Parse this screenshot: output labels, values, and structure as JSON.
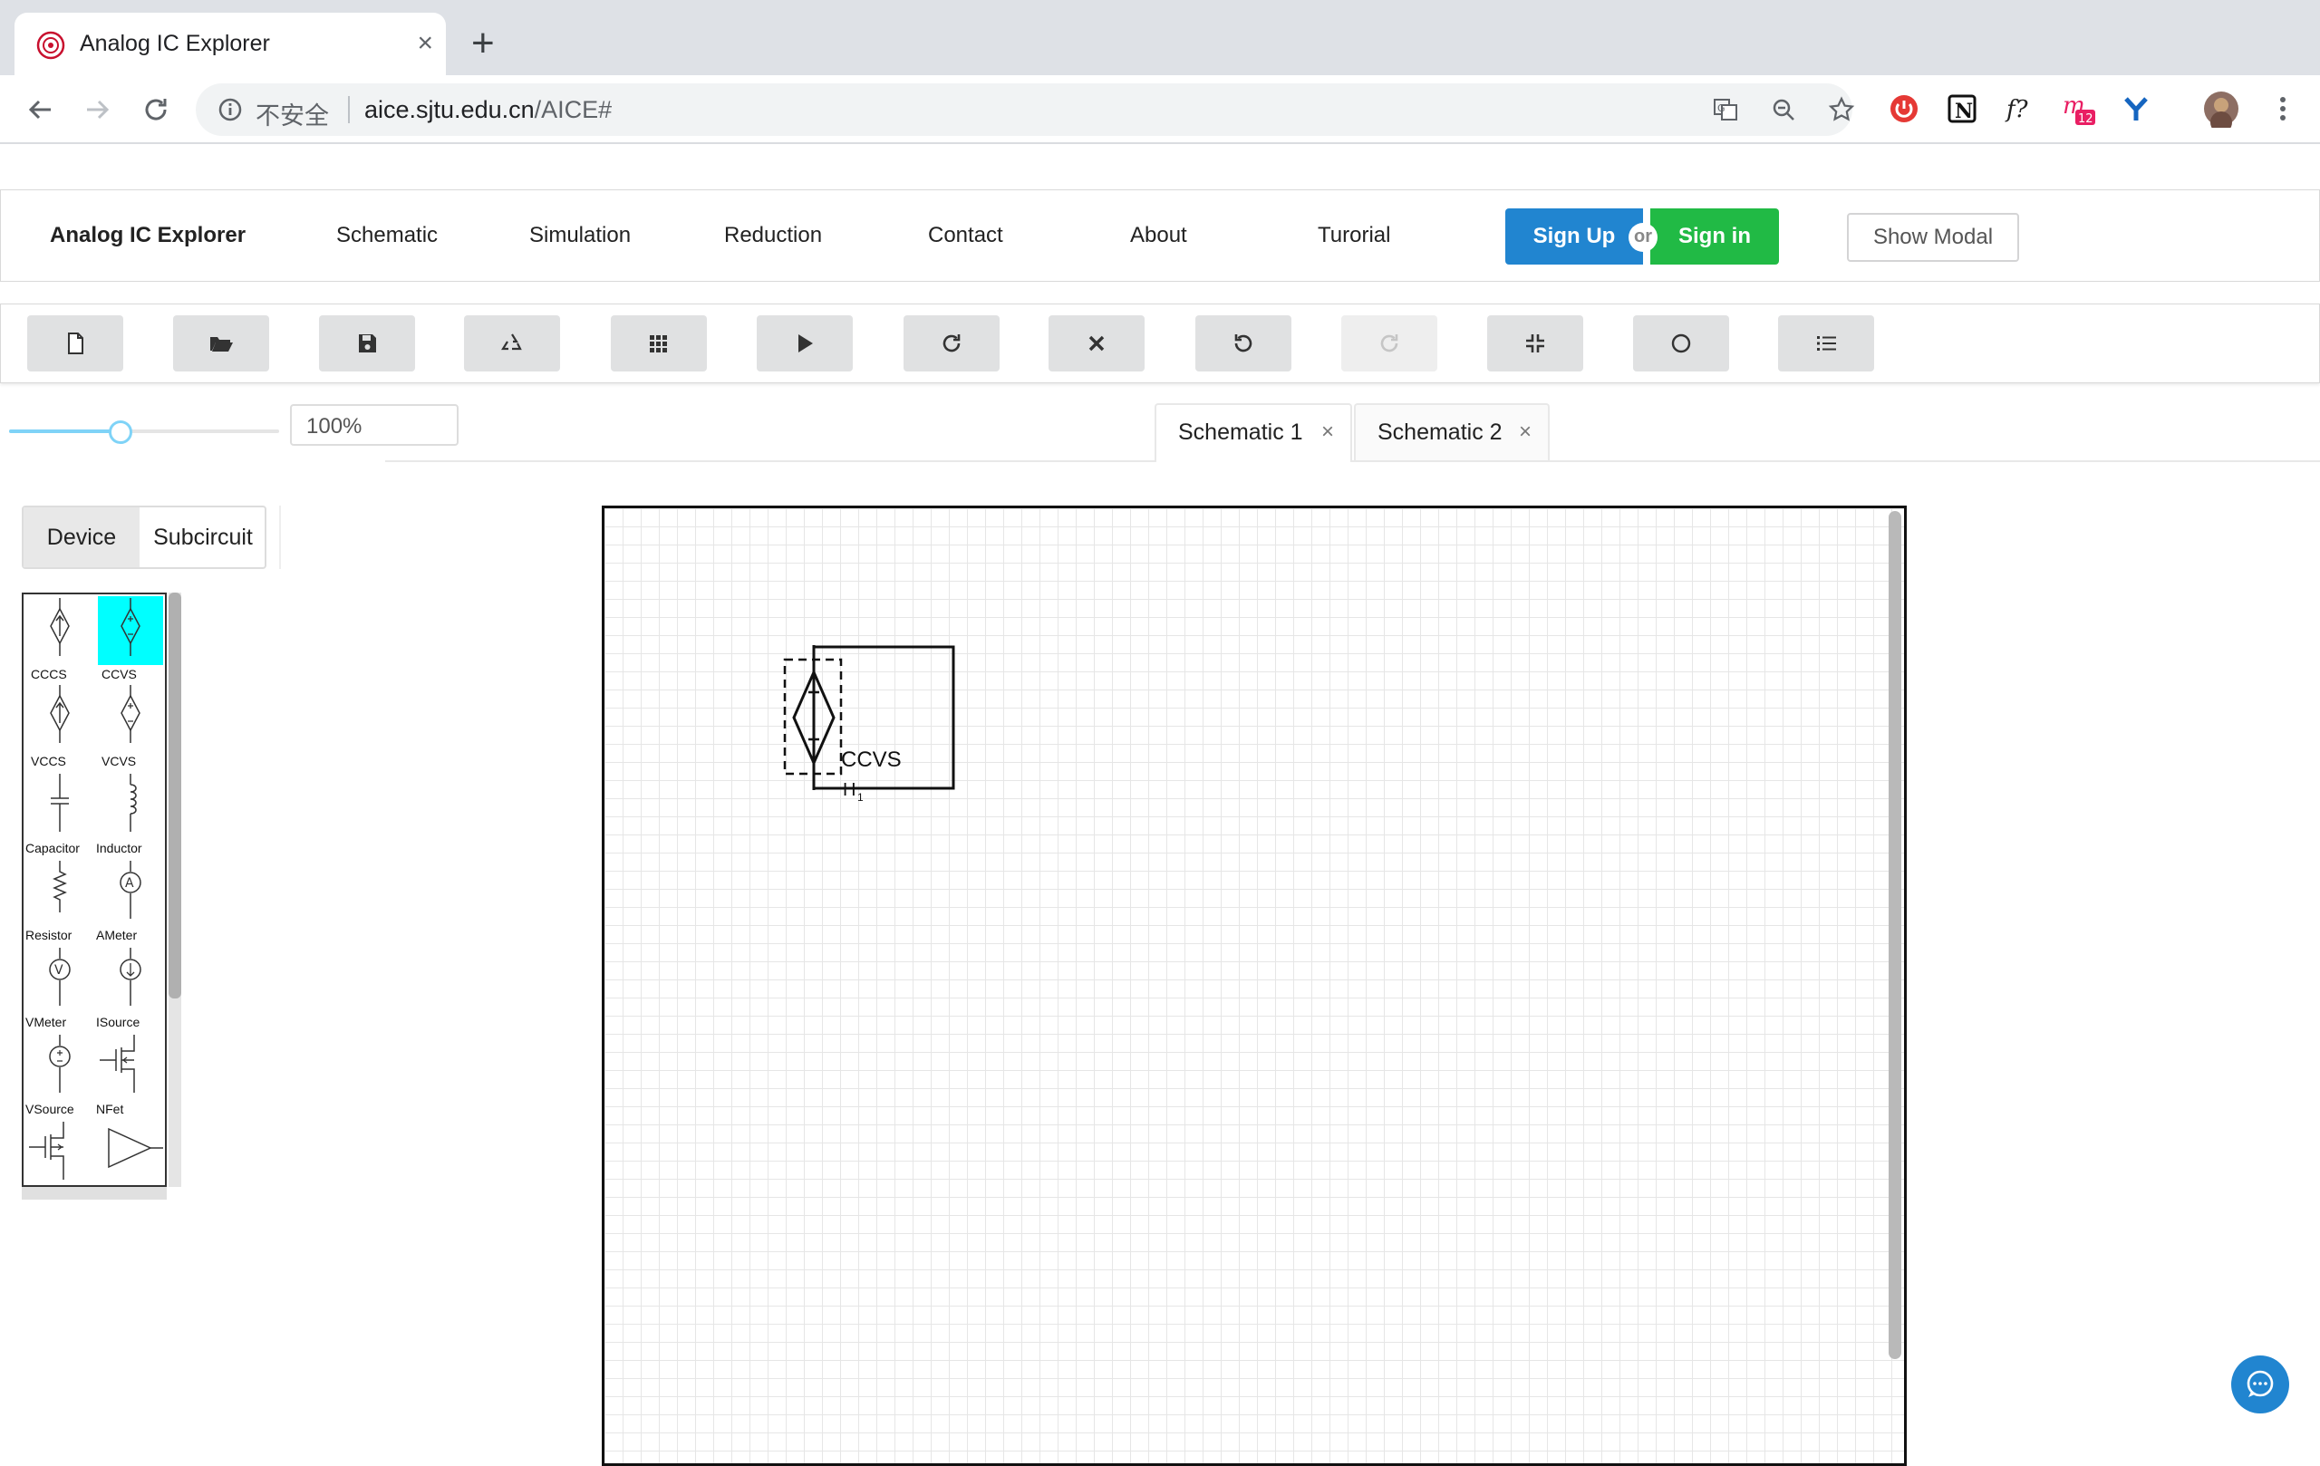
{
  "browser": {
    "tab_title": "Analog IC Explorer",
    "tab_close": "×",
    "new_tab": "+",
    "security_label": "不安全",
    "url_domain": "aice.sjtu.edu.cn",
    "url_path": "/AICE#",
    "extension_badge": "12"
  },
  "navbar": {
    "brand": "Analog IC Explorer",
    "links": [
      "Schematic",
      "Simulation",
      "Reduction",
      "Contact",
      "About",
      "Turorial"
    ],
    "signup": "Sign Up",
    "or": "or",
    "signin": "Sign in",
    "show_modal": "Show Modal"
  },
  "toolbar": {
    "buttons": [
      "new-file",
      "open-folder",
      "save",
      "recycle",
      "grid",
      "play",
      "redo-circle",
      "close",
      "undo",
      "redo",
      "compress",
      "circle",
      "list-ordered"
    ],
    "disabled": [
      "redo"
    ]
  },
  "zoom": {
    "value": "100%",
    "slider_fraction": 0.4
  },
  "doc_tabs": [
    {
      "label": "Schematic 1",
      "close": "×",
      "active": true
    },
    {
      "label": "Schematic 2",
      "close": "×",
      "active": false
    }
  ],
  "panel": {
    "segments": [
      "Device",
      "Subcircuit"
    ],
    "active_segment": "Device",
    "devices": [
      "CCCS",
      "CCVS",
      "VCCS",
      "VCVS",
      "Capacitor",
      "Inductor",
      "Resistor",
      "AMeter",
      "VMeter",
      "ISource",
      "VSource",
      "NFet"
    ],
    "selected_device": "CCVS",
    "highlight_color": "#00ffff"
  },
  "canvas": {
    "component_label": "CCVS",
    "component_designator": "H",
    "component_subscript": "1"
  },
  "colors": {
    "signup": "#2185d0",
    "signin": "#21ba45",
    "slider": "#7fd3f7"
  }
}
